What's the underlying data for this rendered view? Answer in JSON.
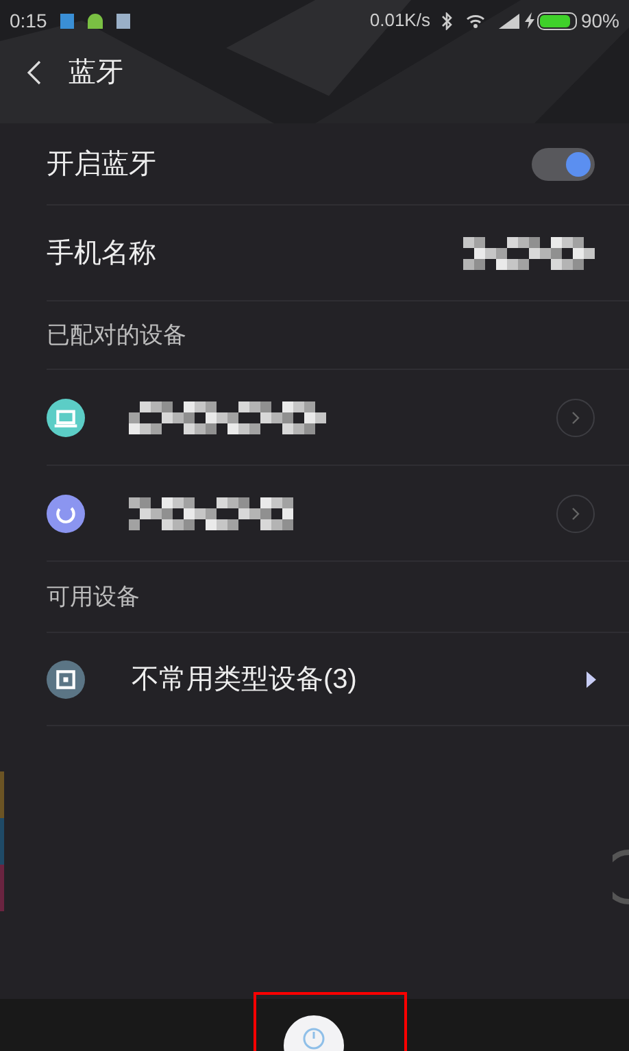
{
  "status_bar": {
    "time": "0:15",
    "speed": "0.01K/s",
    "battery": "90%"
  },
  "header": {
    "title": "蓝牙"
  },
  "settings": [
    {
      "kind": "toggle",
      "label": "开启蓝牙",
      "on": true
    },
    {
      "kind": "value",
      "label": "手机名称"
    }
  ],
  "paired": {
    "title": "已配对的设备",
    "devices": [
      {
        "kind": "laptop",
        "color": "#5ccdc6"
      },
      {
        "kind": "refresh",
        "color": "#8b95f0"
      }
    ]
  },
  "available": {
    "title": "可用设备",
    "items": [
      {
        "kind": "square",
        "color": "#5b7585",
        "label": "不常用类型设备(3)"
      }
    ]
  }
}
